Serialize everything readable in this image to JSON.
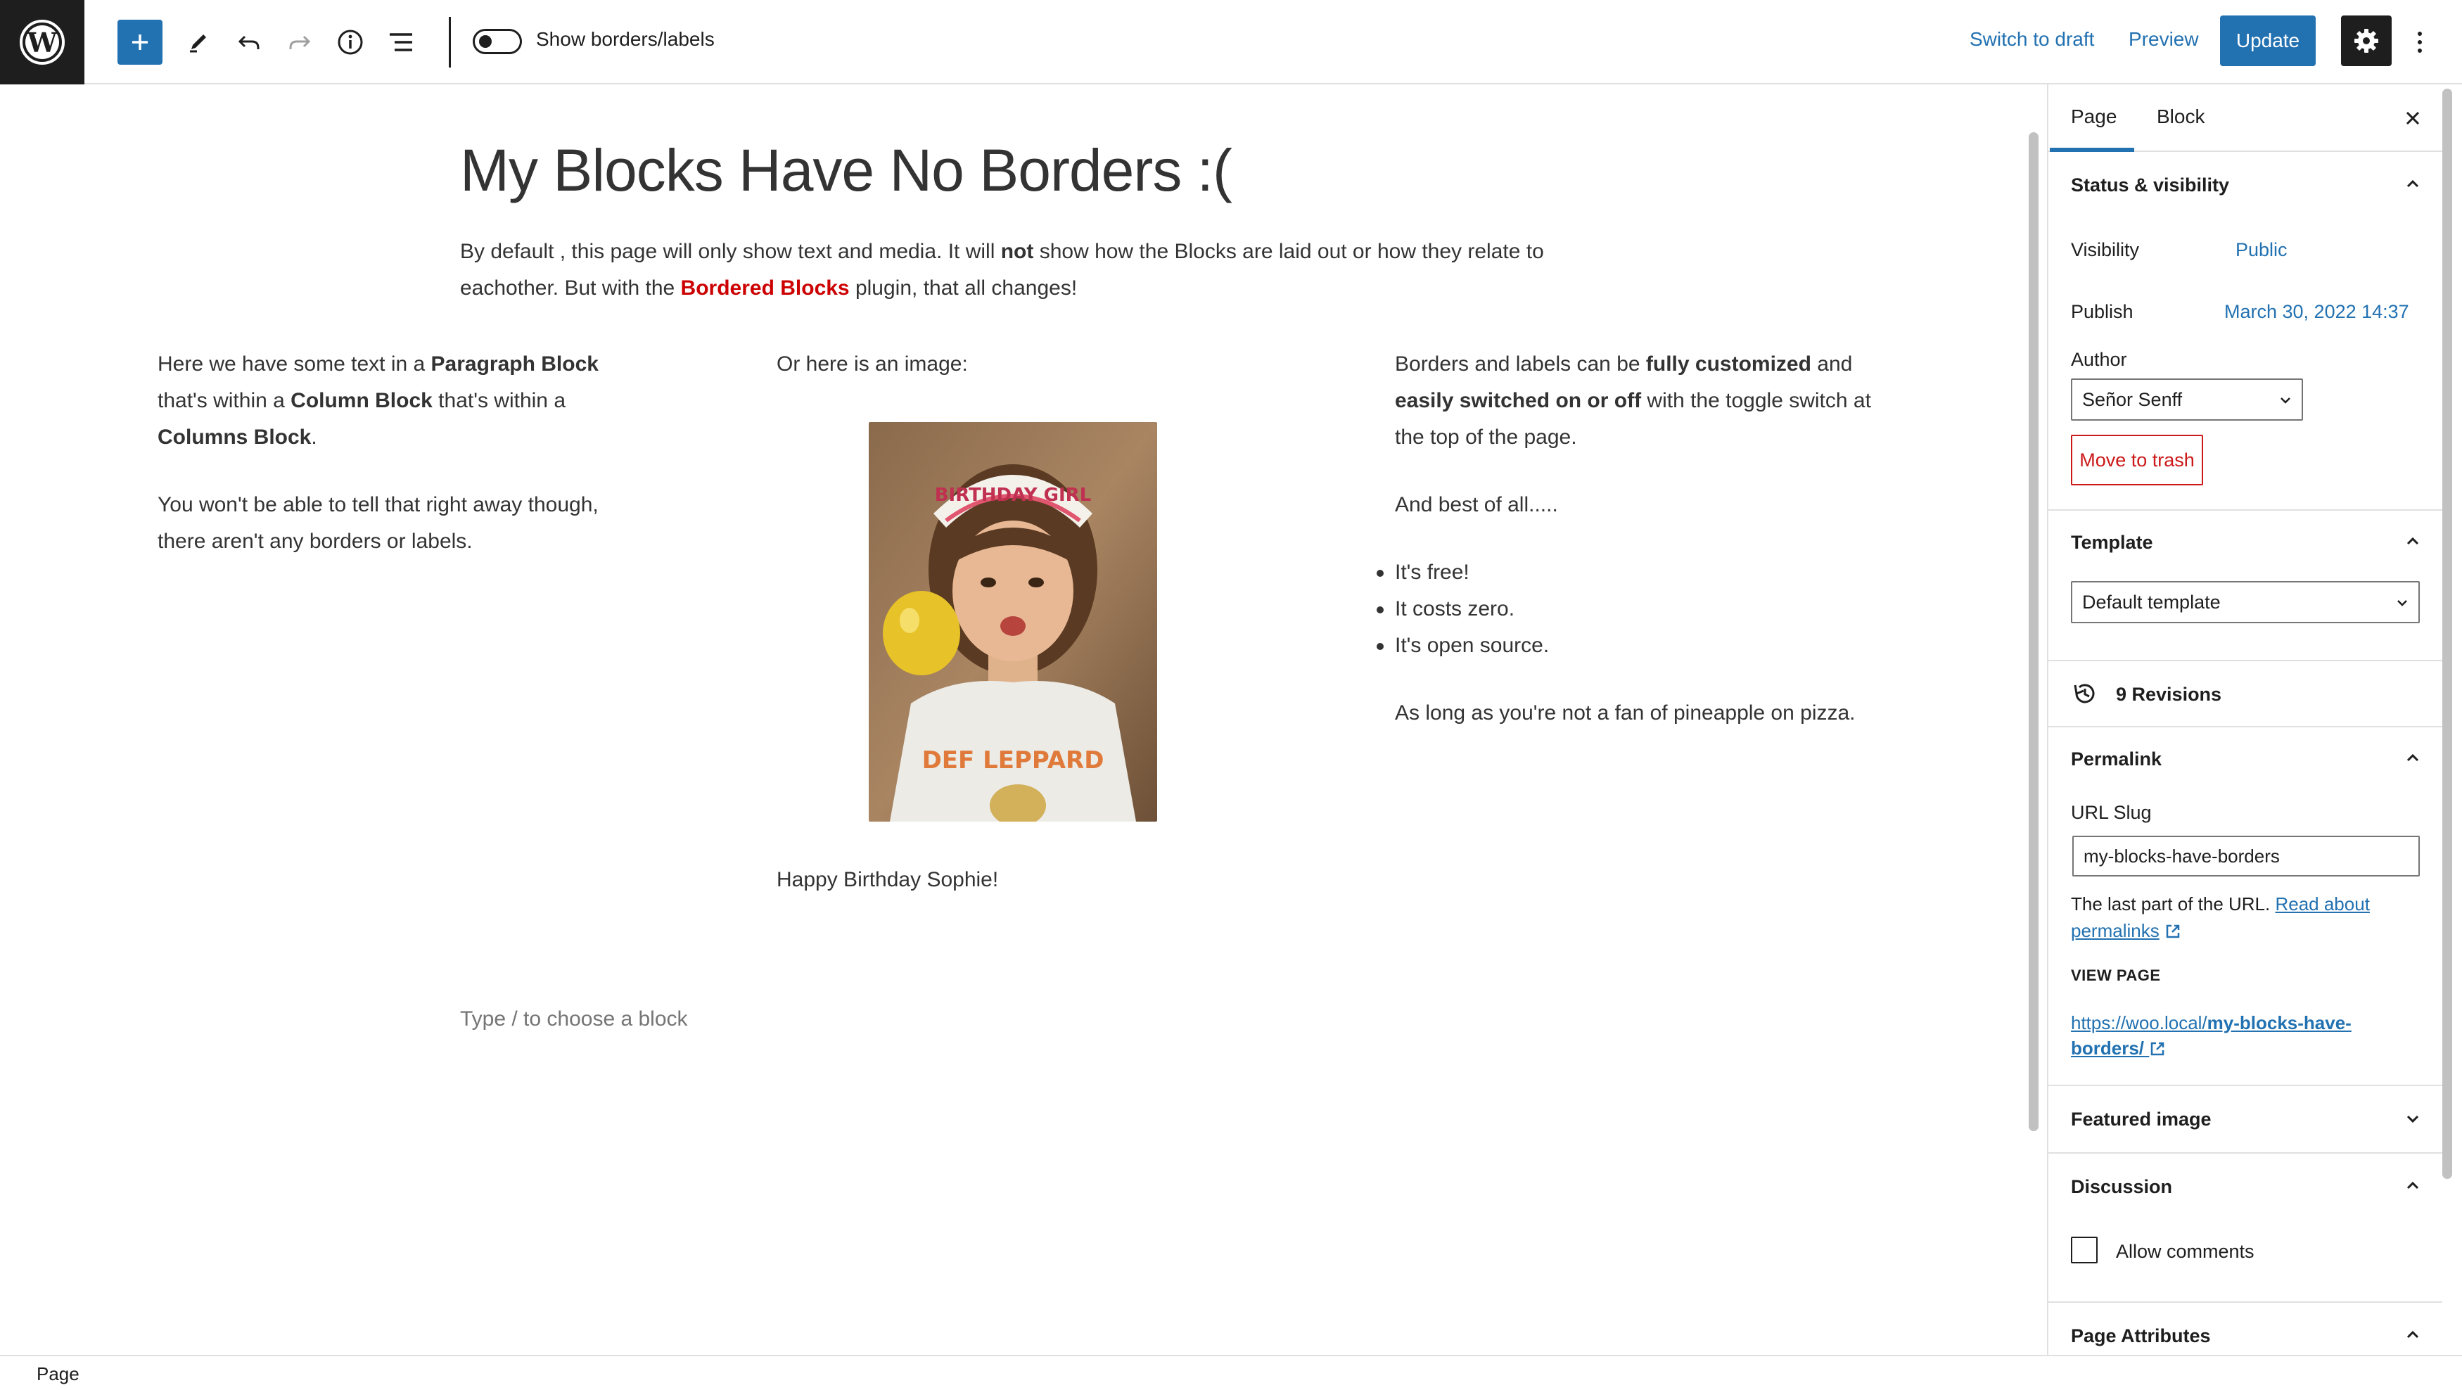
{
  "toolbar": {
    "toggle_label": "Show borders/labels",
    "switch_to_draft": "Switch to draft",
    "preview": "Preview",
    "update": "Update",
    "toggle_on": false
  },
  "post": {
    "title": "My Blocks Have No Borders :(",
    "intro": {
      "p1": "By default , this page will only show text and media. It will ",
      "b1": "not",
      "p2": " show how the Blocks are laid out or how they relate to eachother. But with the ",
      "link": "Bordered Blocks",
      "p3": " plugin, that all changes!"
    },
    "col1": {
      "a1": "Here we have some text in a ",
      "b1": "Paragraph Block",
      "a2": " that's within a ",
      "b2": "Column Block",
      "a3": " that's within a ",
      "b3": "Columns Block",
      "a4": ".",
      "para2": "You won't be able to tell that right away though, there aren't any borders or labels."
    },
    "col2": {
      "lead": "Or here is an image:",
      "caption": "Happy Birthday Sophie!",
      "photo_headband_text": "BIRTHDAY GIRL",
      "photo_shirt_text": "DEF LEPPARD"
    },
    "col3": {
      "a1": "Borders and labels can be ",
      "b1": "fully customized",
      "a2": " and ",
      "b2": "easily switched on or off",
      "a3": " with the toggle switch at the top of the page.",
      "para2": "And best of all.....",
      "bullets": [
        "It's free!",
        "It costs zero.",
        "It's open source."
      ],
      "para3": "As long as you're not a fan of pineapple on pizza."
    },
    "appender_placeholder": "Type / to choose a block"
  },
  "sidebar": {
    "tabs": {
      "page": "Page",
      "block": "Block"
    },
    "status": {
      "title": "Status & visibility",
      "visibility_label": "Visibility",
      "visibility_value": "Public",
      "publish_label": "Publish",
      "publish_value": "March 30, 2022 14:37",
      "author_label": "Author",
      "author_value": "Señor Senff",
      "trash": "Move to trash"
    },
    "template": {
      "title": "Template",
      "value": "Default template"
    },
    "revisions": "9 Revisions",
    "permalink": {
      "title": "Permalink",
      "slug_label": "URL Slug",
      "slug_value": "my-blocks-have-borders",
      "help": "The last part of the URL. ",
      "help_link": "Read about permalinks",
      "view_page": "VIEW PAGE",
      "url_base": "https://woo.local/",
      "url_slug": "my-blocks-have-borders/"
    },
    "featured_image": "Featured image",
    "discussion": {
      "title": "Discussion",
      "allow_comments": "Allow comments"
    },
    "page_attributes": "Page Attributes"
  },
  "footer": {
    "breadcrumb": "Page"
  },
  "colors": {
    "accent": "#2271b1",
    "dark": "#1e1e1e",
    "danger": "#cc1818",
    "plugin_link": "#cc0000"
  }
}
